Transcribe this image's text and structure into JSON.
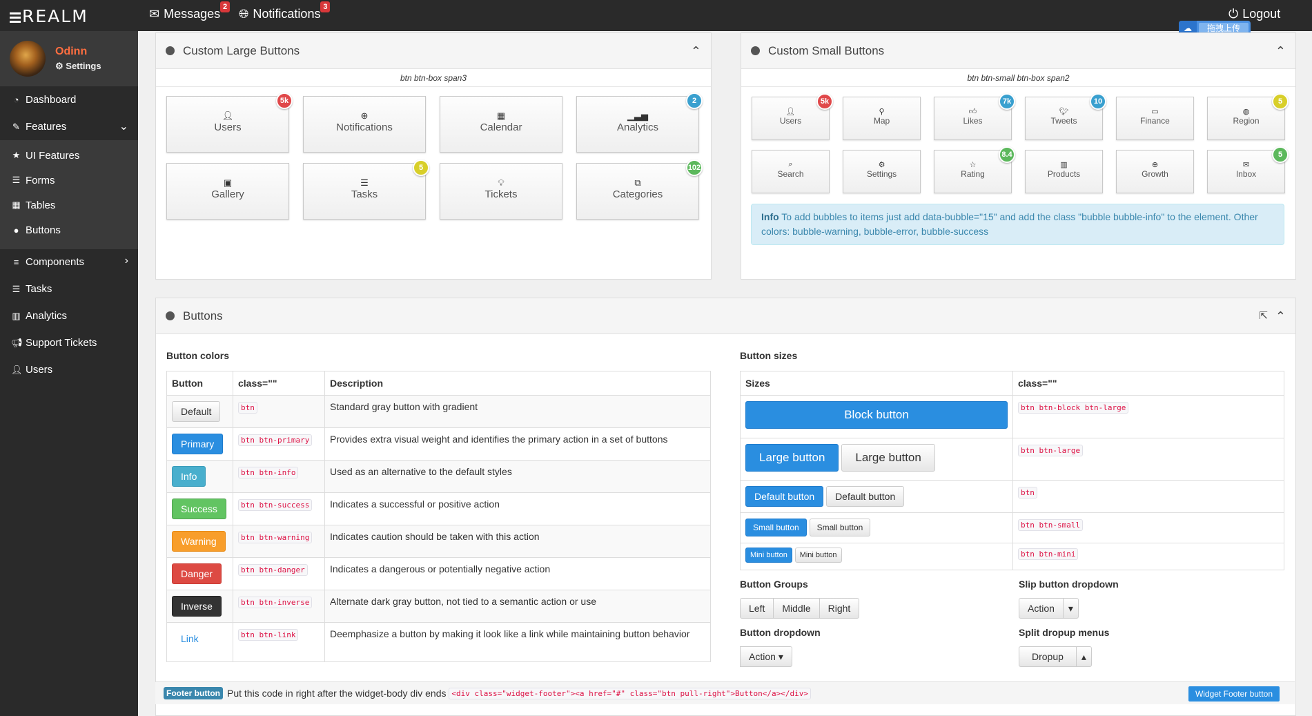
{
  "topbar": {
    "logo": "REALM",
    "messages": "Messages",
    "messages_count": "2",
    "notifications": "Notifications",
    "notifications_count": "3",
    "logout": "Logout",
    "upload_chip": "拖拽上传"
  },
  "profile": {
    "name": "Odinn",
    "settings": "Settings"
  },
  "sidebar": {
    "dashboard": "Dashboard",
    "features": "Features",
    "ui_features": "UI Features",
    "forms": "Forms",
    "tables": "Tables",
    "buttons": "Buttons",
    "components": "Components",
    "tasks": "Tasks",
    "analytics": "Analytics",
    "support": "Support Tickets",
    "users": "Users"
  },
  "large_panel": {
    "title": "Custom Large Buttons",
    "subtitle": "btn btn-box span3",
    "buttons": [
      {
        "label": "Users",
        "icon": "user-icon",
        "bubble": "5k",
        "bubble_type": "error"
      },
      {
        "label": "Notifications",
        "icon": "plus-circle-icon",
        "bubble": "",
        "bubble_type": ""
      },
      {
        "label": "Calendar",
        "icon": "calendar-icon",
        "bubble": "",
        "bubble_type": ""
      },
      {
        "label": "Analytics",
        "icon": "signal-icon",
        "bubble": "2",
        "bubble_type": "info"
      },
      {
        "label": "Gallery",
        "icon": "picture-icon",
        "bubble": "",
        "bubble_type": ""
      },
      {
        "label": "Tasks",
        "icon": "tasks-icon",
        "bubble": "5",
        "bubble_type": "warning"
      },
      {
        "label": "Tickets",
        "icon": "lightbulb-icon",
        "bubble": "",
        "bubble_type": ""
      },
      {
        "label": "Categories",
        "icon": "sitemap-icon",
        "bubble": "102",
        "bubble_type": "success"
      }
    ]
  },
  "small_panel": {
    "title": "Custom Small Buttons",
    "subtitle": "btn btn-small btn-box span2",
    "buttons": [
      {
        "label": "Users",
        "icon": "user-icon",
        "bubble": "5k",
        "bubble_type": "error"
      },
      {
        "label": "Map",
        "icon": "map-marker-icon",
        "bubble": "",
        "bubble_type": ""
      },
      {
        "label": "Likes",
        "icon": "thumbs-up-icon",
        "bubble": "7k",
        "bubble_type": "info"
      },
      {
        "label": "Tweets",
        "icon": "twitter-icon",
        "bubble": "10",
        "bubble_type": "info"
      },
      {
        "label": "Finance",
        "icon": "money-icon",
        "bubble": "",
        "bubble_type": ""
      },
      {
        "label": "Region",
        "icon": "globe-icon",
        "bubble": "5",
        "bubble_type": "warning"
      },
      {
        "label": "Search",
        "icon": "search-icon",
        "bubble": "",
        "bubble_type": ""
      },
      {
        "label": "Settings",
        "icon": "cogs-icon",
        "bubble": "",
        "bubble_type": ""
      },
      {
        "label": "Rating",
        "icon": "star-icon",
        "bubble": "8.4",
        "bubble_type": "success"
      },
      {
        "label": "Products",
        "icon": "barcode-icon",
        "bubble": "",
        "bubble_type": ""
      },
      {
        "label": "Growth",
        "icon": "plus-circle-icon",
        "bubble": "",
        "bubble_type": ""
      },
      {
        "label": "Inbox",
        "icon": "envelope-icon",
        "bubble": "5",
        "bubble_type": "success"
      }
    ],
    "info_label": "Info",
    "info_text": "To add bubbles to items just add data-bubble=\"15\" and add the class \"bubble bubble-info\" to the element. Other colors: bubble-warning, bubble-error, bubble-success"
  },
  "buttons_panel": {
    "title": "Buttons",
    "colors_title": "Button colors",
    "colors_headers": [
      "Button",
      "class=\"\"",
      "Description"
    ],
    "colors_rows": [
      {
        "btn": "Default",
        "cls": "btn",
        "desc": "Standard gray button with gradient",
        "style": ""
      },
      {
        "btn": "Primary",
        "cls": "btn btn-primary",
        "desc": "Provides extra visual weight and identifies the primary action in a set of buttons",
        "style": "b-primary"
      },
      {
        "btn": "Info",
        "cls": "btn btn-info",
        "desc": "Used as an alternative to the default styles",
        "style": "b-info"
      },
      {
        "btn": "Success",
        "cls": "btn btn-success",
        "desc": "Indicates a successful or positive action",
        "style": "b-success"
      },
      {
        "btn": "Warning",
        "cls": "btn btn-warning",
        "desc": "Indicates caution should be taken with this action",
        "style": "b-warning"
      },
      {
        "btn": "Danger",
        "cls": "btn btn-danger",
        "desc": "Indicates a dangerous or potentially negative action",
        "style": "b-danger"
      },
      {
        "btn": "Inverse",
        "cls": "btn btn-inverse",
        "desc": "Alternate dark gray button, not tied to a semantic action or use",
        "style": "b-inverse"
      },
      {
        "btn": "Link",
        "cls": "btn btn-link",
        "desc": "Deemphasize a button by making it look like a link while maintaining button behavior",
        "style": "b-link"
      }
    ],
    "sizes_title": "Button sizes",
    "sizes_headers": [
      "Sizes",
      "class=\"\""
    ],
    "block_button": "Block button",
    "block_cls": "btn btn-block btn-large",
    "large_primary": "Large button",
    "large_default": "Large button",
    "large_cls": "btn btn-large",
    "default_primary": "Default button",
    "default_default": "Default button",
    "default_cls": "btn",
    "small_primary": "Small button",
    "small_default": "Small button",
    "small_cls": "btn btn-small",
    "mini_primary": "Mini button",
    "mini_default": "Mini button",
    "mini_cls": "btn btn-mini",
    "groups_title": "Button Groups",
    "group_left": "Left",
    "group_middle": "Middle",
    "group_right": "Right",
    "slip_title": "Slip button dropdown",
    "slip_action": "Action",
    "dropdown_title": "Button dropdown",
    "dropdown_action": "Action",
    "split_title": "Split dropup menus",
    "split_action": "Dropup"
  },
  "footer": {
    "label": "Footer button",
    "text": "Put this code in right after the widget-body div ends",
    "code": "<div class=\"widget-footer\"><a href=\"#\" class=\"btn pull-right\">Button</a></div>",
    "button": "Widget Footer button"
  }
}
